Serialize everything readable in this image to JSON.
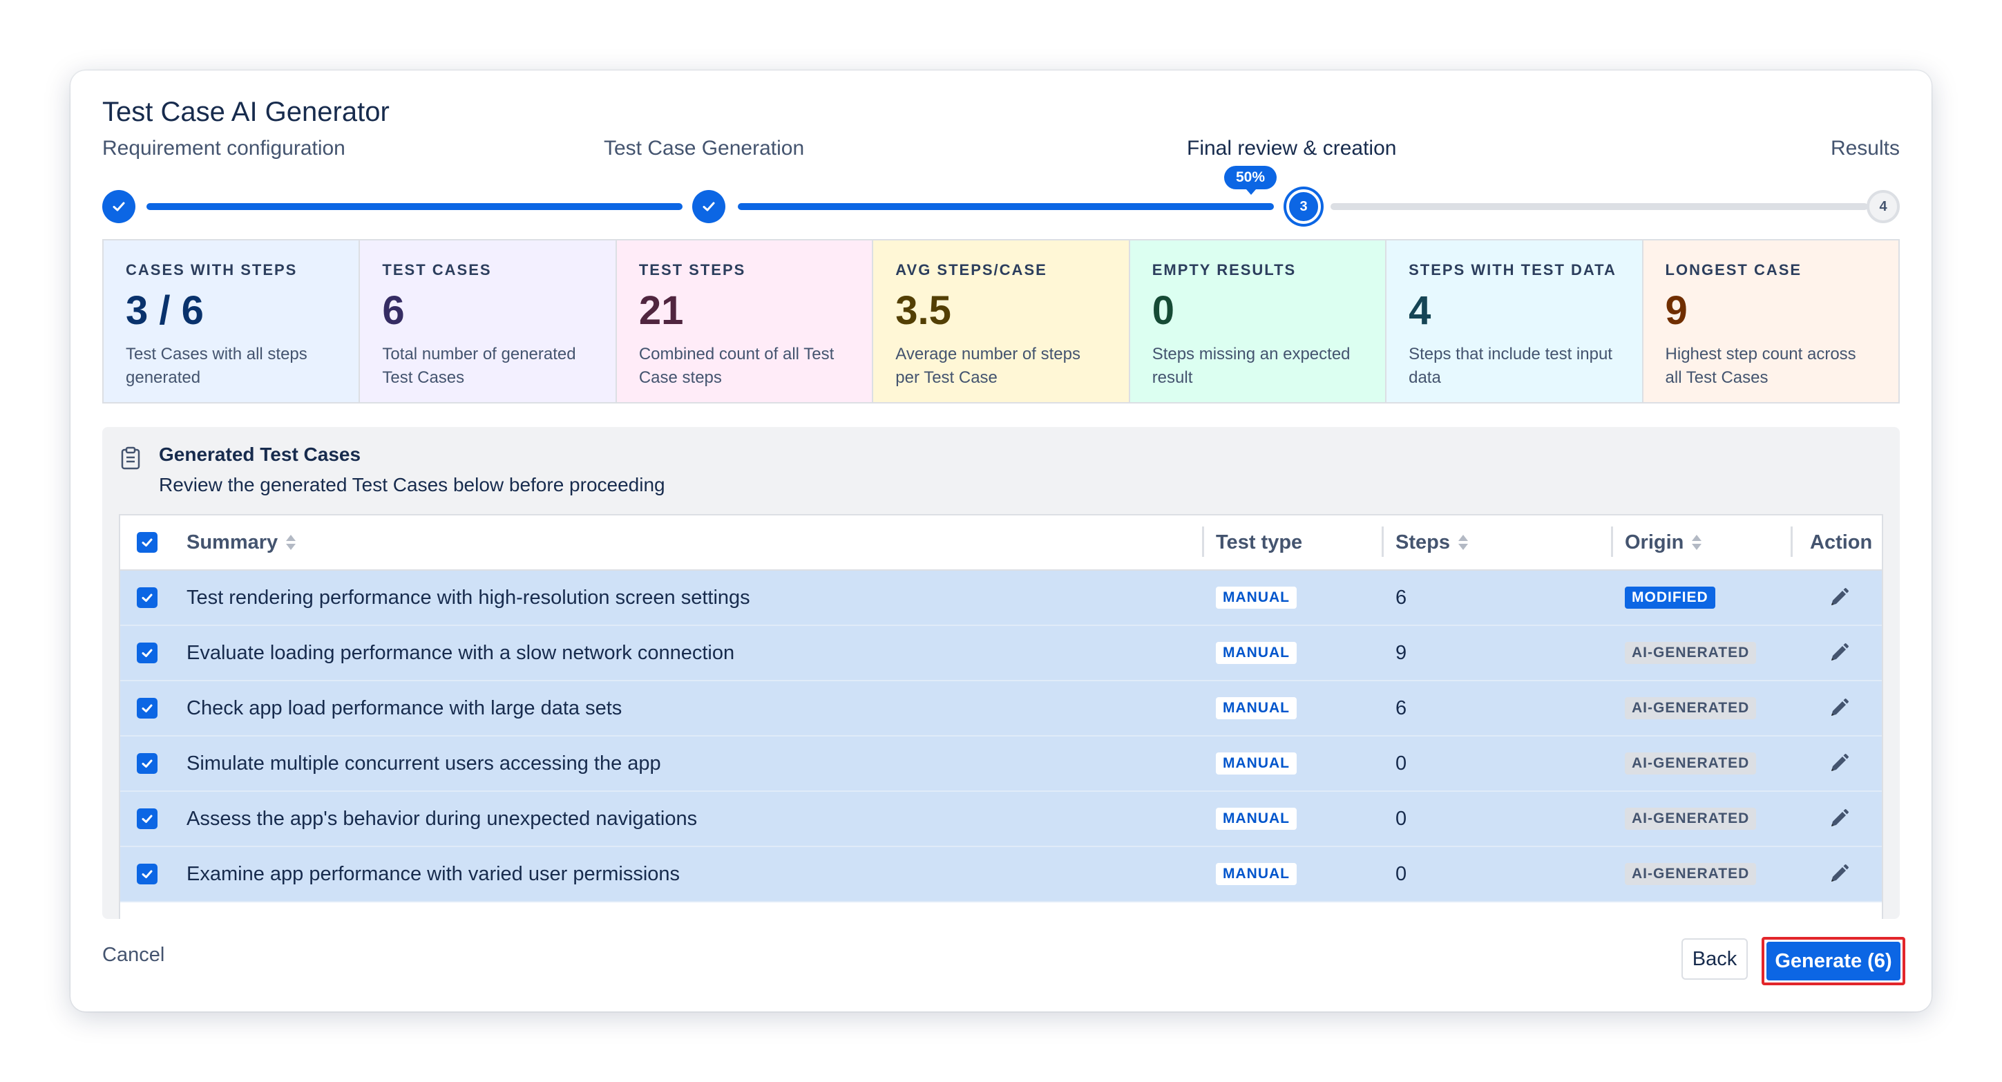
{
  "dialog": {
    "title": "Test Case AI Generator"
  },
  "steps": [
    {
      "label": "Requirement configuration",
      "status": "done"
    },
    {
      "label": "Test Case Generation",
      "status": "done"
    },
    {
      "label": "Final review & creation",
      "status": "current",
      "number": "3"
    },
    {
      "label": "Results",
      "status": "todo",
      "number": "4"
    }
  ],
  "progress": {
    "percent_label": "50%",
    "value": 0.5
  },
  "stats": [
    {
      "label": "CASES WITH STEPS",
      "value": "3 / 6",
      "description": "Test Cases with all steps generated",
      "bg": "#e9f2ff",
      "color": "#09326c"
    },
    {
      "label": "TEST CASES",
      "value": "6",
      "description": "Total number of generated Test Cases",
      "bg": "#f3f0ff",
      "color": "#352c63"
    },
    {
      "label": "TEST STEPS",
      "value": "21",
      "description": "Combined count of all Test Case steps",
      "bg": "#ffecf8",
      "color": "#50253f"
    },
    {
      "label": "AVG STEPS/CASE",
      "value": "3.5",
      "description": "Average number of steps per Test Case",
      "bg": "#fff7d6",
      "color": "#533f04"
    },
    {
      "label": "EMPTY RESULTS",
      "value": "0",
      "description": "Steps missing an expected result",
      "bg": "#dcfff1",
      "color": "#164b35"
    },
    {
      "label": "STEPS WITH TEST DATA",
      "value": "4",
      "description": "Steps that include test input data",
      "bg": "#e7f9ff",
      "color": "#164555"
    },
    {
      "label": "LONGEST CASE",
      "value": "9",
      "description": "Highest step count across all Test Cases",
      "bg": "#fff3eb",
      "color": "#702e00"
    }
  ],
  "panel": {
    "title": "Generated Test Cases",
    "subtitle": "Review the generated Test Cases below before proceeding"
  },
  "table": {
    "columns": {
      "summary": "Summary",
      "test_type": "Test type",
      "steps": "Steps",
      "origin": "Origin",
      "action": "Action"
    },
    "rows": [
      {
        "summary": "Test rendering performance with high-resolution screen settings",
        "test_type": "MANUAL",
        "steps": "6",
        "origin": "MODIFIED",
        "checked": true
      },
      {
        "summary": "Evaluate loading performance with a slow network connection",
        "test_type": "MANUAL",
        "steps": "9",
        "origin": "AI-GENERATED",
        "checked": true
      },
      {
        "summary": "Check app load performance with large data sets",
        "test_type": "MANUAL",
        "steps": "6",
        "origin": "AI-GENERATED",
        "checked": true
      },
      {
        "summary": "Simulate multiple concurrent users accessing the app",
        "test_type": "MANUAL",
        "steps": "0",
        "origin": "AI-GENERATED",
        "checked": true
      },
      {
        "summary": "Assess the app's behavior during unexpected navigations",
        "test_type": "MANUAL",
        "steps": "0",
        "origin": "AI-GENERATED",
        "checked": true
      },
      {
        "summary": "Examine app performance with varied user permissions",
        "test_type": "MANUAL",
        "steps": "0",
        "origin": "AI-GENERATED",
        "checked": true
      }
    ]
  },
  "footer": {
    "cancel_label": "Cancel",
    "back_label": "Back",
    "generate_label": "Generate (6)"
  },
  "icons": {
    "step_done": "check-icon",
    "panel": "clipboard-icon",
    "row_action": "pencil-icon",
    "sort": "sort-icon"
  },
  "colors": {
    "primary": "#0c66e4",
    "row_selected": "#cfe1f7",
    "highlight_outline": "#e2262b"
  }
}
